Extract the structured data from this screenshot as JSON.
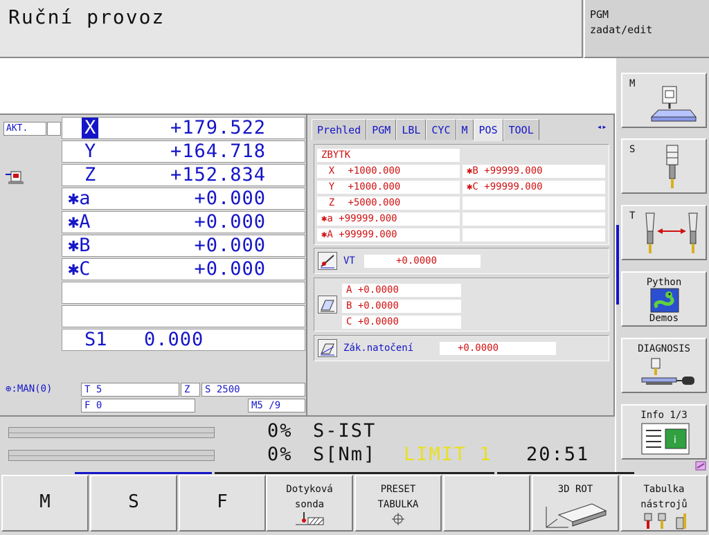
{
  "header": {
    "mode_title": "Ruční provoz",
    "pgm_line1": "PGM",
    "pgm_line2": "zadat/edit"
  },
  "left": {
    "akt_label": "AKT.",
    "positions": [
      {
        "axis": "X",
        "value": "+179.522",
        "selected": true
      },
      {
        "axis": "Y",
        "value": "+164.718"
      },
      {
        "axis": "Z",
        "value": "+152.834"
      },
      {
        "axis": "✱a",
        "value": "+0.000"
      },
      {
        "axis": "✱A",
        "value": "+0.000"
      },
      {
        "axis": "✱B",
        "value": "+0.000"
      },
      {
        "axis": "✱C",
        "value": "+0.000"
      }
    ],
    "spindle_label": "S1",
    "spindle_value": "0.000",
    "status": {
      "man": "⊕:MAN(0)",
      "tool": "T 5",
      "axis": "Z",
      "speed": "S 2500",
      "feed": "F 0",
      "mcode": "M5 /9"
    }
  },
  "tabs": [
    "Prehled",
    "PGM",
    "LBL",
    "CYC",
    "M",
    "POS",
    "TOOL"
  ],
  "tab_arrows": "◂▸",
  "pos_tab": {
    "zbytk_title": "ZBYTK",
    "rows_left": [
      {
        "label": "X",
        "value": "+1000.000"
      },
      {
        "label": "Y",
        "value": "+1000.000"
      },
      {
        "label": "Z",
        "value": "+5000.000"
      },
      {
        "label": "✱a",
        "value": "+99999.000"
      },
      {
        "label": "✱A",
        "value": "+99999.000"
      }
    ],
    "rows_right": [
      {
        "label": "✱B",
        "value": "+99999.000"
      },
      {
        "label": "✱C",
        "value": "+99999.000"
      }
    ],
    "vt_label": "VT",
    "vt_value": "+0.0000",
    "abc": [
      {
        "label": "A",
        "value": "+0.0000"
      },
      {
        "label": "B",
        "value": "+0.0000"
      },
      {
        "label": "C",
        "value": "+0.0000"
      }
    ],
    "rot_label": "Zák.natočení",
    "rot_value": "+0.0000"
  },
  "side_buttons": {
    "m": "M",
    "s": "S",
    "t": "T",
    "python_1": "Python",
    "python_2": "Demos",
    "diagnosis": "DIAGNOSIS",
    "info": "Info 1/3"
  },
  "bars": {
    "pct1": "0%",
    "label1": "S-IST",
    "pct2": "0%",
    "label2": "S[Nm]",
    "limit": "LIMIT 1",
    "time": "20:51"
  },
  "softkeys": {
    "m": "M",
    "s": "S",
    "f": "F",
    "probe_1": "Dotyková",
    "probe_2": "sonda",
    "preset_1": "PRESET",
    "preset_2": "TABULKA",
    "rot3d": "3D ROT",
    "tooltab_1": "Tabulka",
    "tooltab_2": "nástrojů"
  },
  "colors": {
    "blue": "#1515c8",
    "red": "#d01010",
    "limit": "#e8e020"
  }
}
